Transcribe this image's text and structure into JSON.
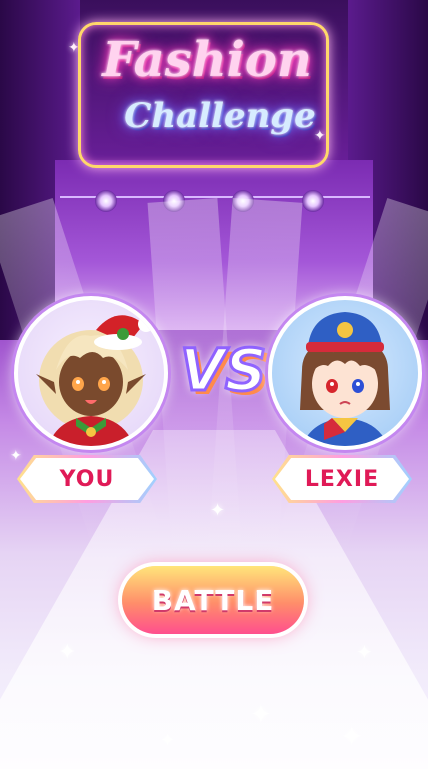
{
  "title": {
    "line1": "Fashion",
    "line2": "Challenge"
  },
  "players": {
    "left": {
      "name": "YOU"
    },
    "right": {
      "name": "LEXIE"
    }
  },
  "vs_label": "VS",
  "battle_button": {
    "label": "BATTLE"
  },
  "colors": {
    "name_text": "#e01a57",
    "title_pink": "#ff4fc8",
    "title_blue": "#6b8cff",
    "button_top": "#ffe57a",
    "button_bottom": "#ff4f8e"
  },
  "icons": [
    "sparkle-icon"
  ]
}
